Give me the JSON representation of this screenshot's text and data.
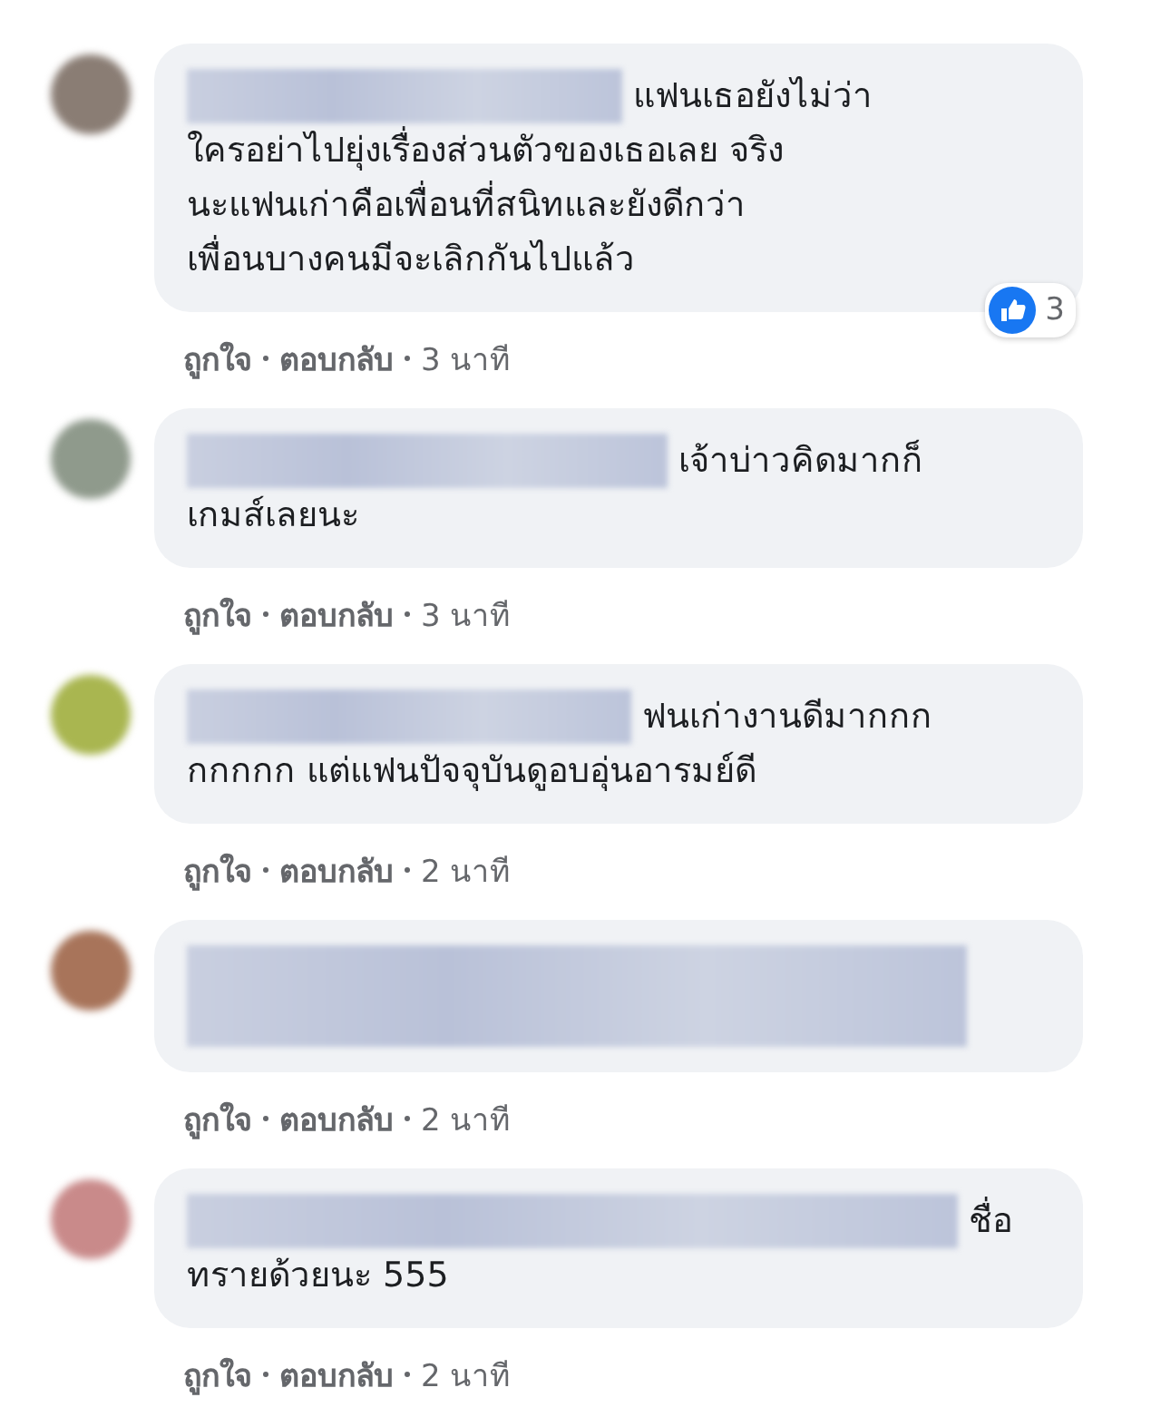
{
  "comments": [
    {
      "lines": [
        "แฟนเธอยังไม่ว่า",
        "ใครอย่าไปยุ่งเรื่องส่วนตัวของเธอเลย จริง",
        "นะแฟนเก่าคือเพื่อนที่สนิทและยังดีกว่า",
        "เพื่อนบางคนมีจะเลิกกันไปแล้ว"
      ],
      "reactions": {
        "count": "3"
      },
      "actions": {
        "like": "ถูกใจ",
        "reply": "ตอบกลับ",
        "time": "3 นาที"
      }
    },
    {
      "lines": [
        "เจ้าบ่าวคิดมากก็",
        "เกมส์เลยนะ"
      ],
      "actions": {
        "like": "ถูกใจ",
        "reply": "ตอบกลับ",
        "time": "3 นาที"
      }
    },
    {
      "lines": [
        "ฟนเก่างานดีมากกก",
        "กกกกก แต่แฟนปัจจุบันดูอบอุ่นอารมย์ดี"
      ],
      "actions": {
        "like": "ถูกใจ",
        "reply": "ตอบกลับ",
        "time": "2 นาที"
      }
    },
    {
      "actions": {
        "like": "ถูกใจ",
        "reply": "ตอบกลับ",
        "time": "2 นาที"
      }
    },
    {
      "lines": [
        "ชื่อ",
        "ทรายด้วยนะ 555"
      ],
      "actions": {
        "like": "ถูกใจ",
        "reply": "ตอบกลับ",
        "time": "2 นาที"
      }
    }
  ]
}
